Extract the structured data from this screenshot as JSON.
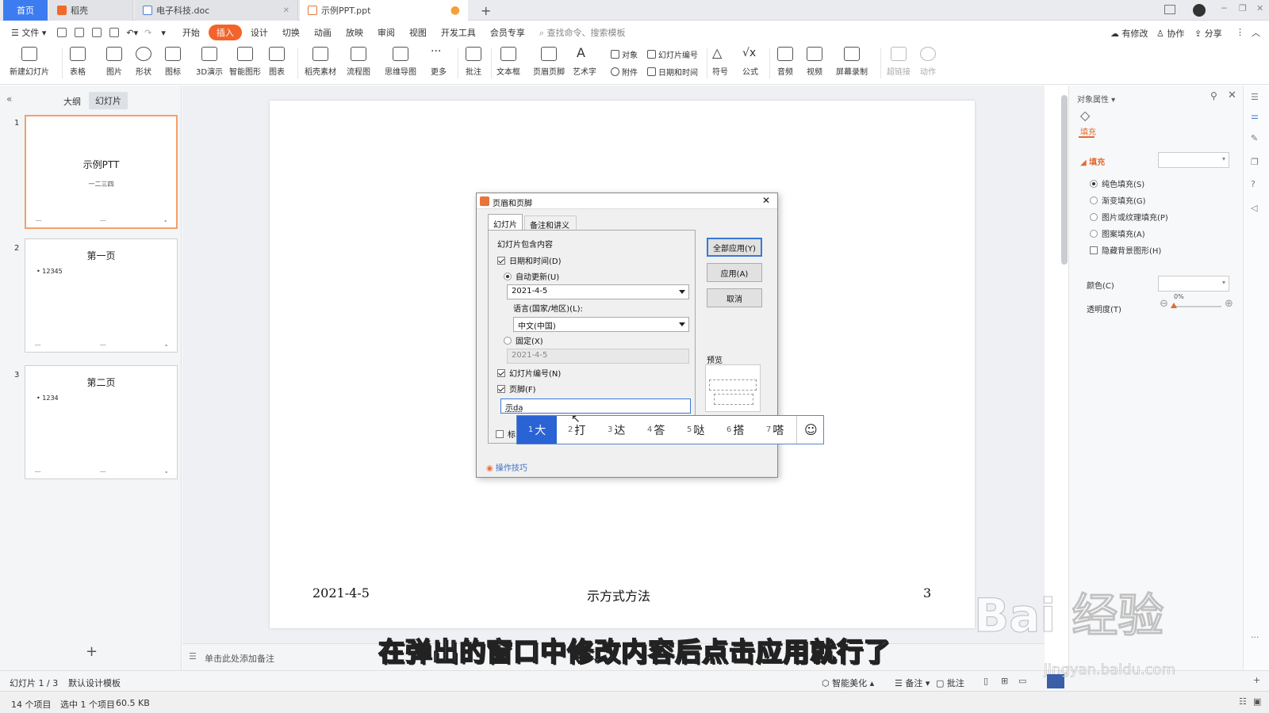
{
  "tabs": [
    {
      "label": "首页"
    },
    {
      "label": "稻壳"
    },
    {
      "label": "电子科技.doc"
    },
    {
      "label": "示例PPT.ppt"
    }
  ],
  "menu": {
    "file": "文件",
    "items": [
      "开始",
      "插入",
      "设计",
      "切换",
      "动画",
      "放映",
      "审阅",
      "视图",
      "开发工具",
      "会员专享"
    ],
    "search_placeholder": "查找命令、搜索模板",
    "right": [
      "有修改",
      "协作",
      "分享"
    ]
  },
  "ribbon": {
    "new_slide": "新建幻灯片",
    "table": "表格",
    "picture": "图片",
    "shape": "形状",
    "icon": "图标",
    "demo3d": "3D演示",
    "smart": "智能图形",
    "chart": "图表",
    "docer": "稻壳素材",
    "flow": "流程图",
    "mind": "思维导图",
    "more": "更多",
    "comment": "批注",
    "textbox": "文本框",
    "header_footer": "页眉页脚",
    "art": "艺术字",
    "object": "对象",
    "slide_num": "幻灯片编号",
    "attach": "附件",
    "datetime": "日期和时间",
    "symbol": "符号",
    "formula": "公式",
    "audio": "音频",
    "video": "视频",
    "record": "屏幕录制",
    "hyperlink": "超链接",
    "action": "动作"
  },
  "left_pane": {
    "tab_outline": "大纲",
    "tab_slides": "幻灯片",
    "slides": [
      {
        "num": "1",
        "title": "示例PTT",
        "sub": "一二三四"
      },
      {
        "num": "2",
        "title": "第一页",
        "bullet": "• 12345"
      },
      {
        "num": "3",
        "title": "第二页",
        "bullet": "• 1234"
      }
    ]
  },
  "slide_footer": {
    "date": "2021-4-5",
    "center": "示方式方法",
    "number": "3"
  },
  "notes_placeholder": "单击此处添加备注",
  "dialog": {
    "title": "页眉和页脚",
    "tab_slide": "幻灯片",
    "tab_notes": "备注和讲义",
    "group_label": "幻灯片包含内容",
    "datetime_label": "日期和时间(D)",
    "auto_update": "自动更新(U)",
    "auto_value": "2021-4-5",
    "language_label": "语言(国家/地区)(L):",
    "language_value": "中文(中国)",
    "fixed_label": "固定(X)",
    "fixed_value": "2021-4-5",
    "slide_number": "幻灯片编号(N)",
    "footer": "页脚(F)",
    "footer_input": "示da",
    "title_partial": "标",
    "apply_all": "全部应用(Y)",
    "apply": "应用(A)",
    "cancel": "取消",
    "preview": "预览",
    "tips": "操作技巧"
  },
  "ime": {
    "candidates": [
      {
        "n": "1",
        "t": "大"
      },
      {
        "n": "2",
        "t": "打"
      },
      {
        "n": "3",
        "t": "达"
      },
      {
        "n": "4",
        "t": "答"
      },
      {
        "n": "5",
        "t": "哒"
      },
      {
        "n": "6",
        "t": "搭"
      },
      {
        "n": "7",
        "t": "嗒"
      }
    ],
    "emoji": "☺"
  },
  "right_panel": {
    "title": "对象属性",
    "tab": "填充",
    "section": "填充",
    "options": [
      "纯色填充(S)",
      "渐变填充(G)",
      "图片或纹理填充(P)",
      "图案填充(A)"
    ],
    "hide_bg": "隐藏背景图形(H)",
    "color_label": "颜色(C)",
    "transparency_label": "透明度(T)",
    "transparency_value": "0%"
  },
  "status": {
    "slide_info": "幻灯片 1 / 3",
    "template": "默认设计模板",
    "beautify": "智能美化",
    "notes": "备注",
    "comment": "批注"
  },
  "bottom": {
    "items": "14 个项目",
    "selected": "选中 1 个项目",
    "size": "60.5 KB"
  },
  "subtitle": "在弹出的窗口中修改内容后点击应用就行了",
  "watermark": {
    "brand": "Bai 经验",
    "url": "jingyan.baidu.com"
  },
  "colors": {
    "accent": "#f3642a",
    "home_tab": "#3c7cf0",
    "ime_highlight": "#2a63d4"
  }
}
